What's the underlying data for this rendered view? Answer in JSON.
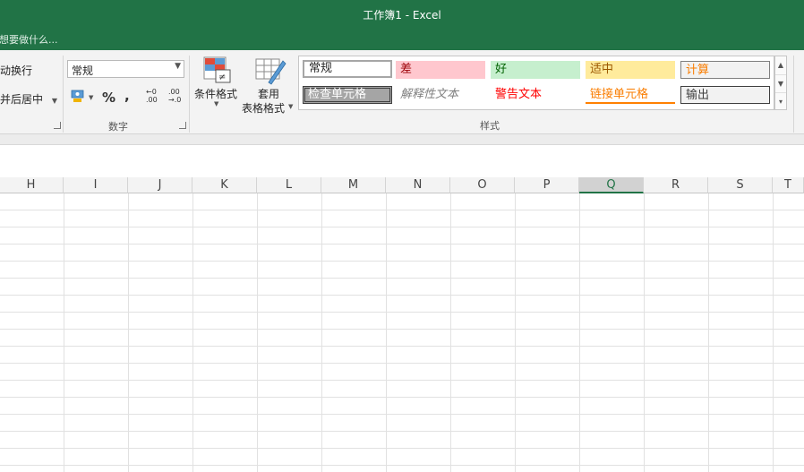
{
  "window": {
    "title": "工作簿1 - Excel",
    "tell_me": "想要做什么..."
  },
  "alignment": {
    "wrap_text": "动换行",
    "merge_center": "并后居中"
  },
  "number": {
    "format_value": "常规",
    "percent": "%",
    "comma": ",",
    "inc_decimal_top": "←0",
    "inc_decimal_bottom": ".00",
    "dec_decimal_top": ".00",
    "dec_decimal_bottom": "→.0",
    "group_label": "数字"
  },
  "styles": {
    "conditional_format": "条件格式",
    "table_format_line1": "套用",
    "table_format_line2": "表格格式",
    "group_label": "样式",
    "cells": [
      {
        "label": "常规",
        "bg": "#ffffff",
        "color": "#000000"
      },
      {
        "label": "差",
        "bg": "#ffc7ce",
        "color": "#9c0006"
      },
      {
        "label": "好",
        "bg": "#c6efce",
        "color": "#006100"
      },
      {
        "label": "适中",
        "bg": "#ffeb9c",
        "color": "#9c5700"
      },
      {
        "label": "计算",
        "bg": "#f2f2f2",
        "color": "#fa7d00"
      },
      {
        "label": "检查单元格",
        "bg": "#a5a5a5",
        "color": "#ffffff"
      },
      {
        "label": "解释性文本",
        "bg": "#ffffff",
        "color": "#7f7f7f"
      },
      {
        "label": "警告文本",
        "bg": "#ffffff",
        "color": "#ff0000"
      },
      {
        "label": "链接单元格",
        "bg": "#ffffff",
        "color": "#fa7d00"
      },
      {
        "label": "输出",
        "bg": "#f2f2f2",
        "color": "#3f3f3f"
      }
    ]
  },
  "columns": [
    "H",
    "I",
    "J",
    "K",
    "L",
    "M",
    "N",
    "O",
    "P",
    "Q",
    "R",
    "S",
    "T"
  ],
  "selected_column": "Q",
  "colors": {
    "accent": "#217346"
  }
}
